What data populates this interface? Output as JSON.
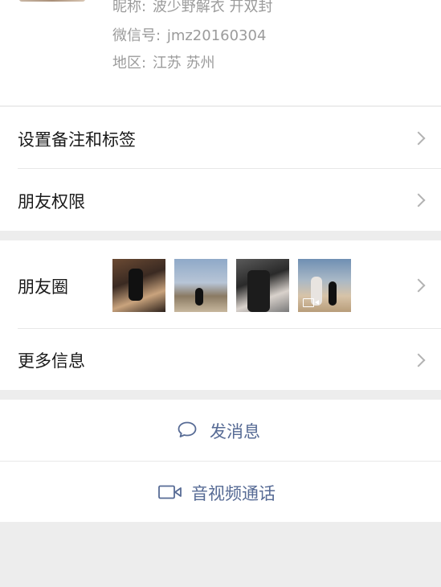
{
  "profile": {
    "nickname_label": "昵称:",
    "nickname_value": "波少野解衣 开双封",
    "wechat_id_label": "微信号:",
    "wechat_id_value": "jmz20160304",
    "region_label": "地区:",
    "region_value": "江苏 苏州"
  },
  "menu": {
    "remark_tags": "设置备注和标签",
    "friend_permissions": "朋友权限",
    "moments": "朋友圈",
    "more_info": "更多信息"
  },
  "moments_thumbnails": [
    {
      "kind": "photo"
    },
    {
      "kind": "photo"
    },
    {
      "kind": "photo"
    },
    {
      "kind": "video"
    }
  ],
  "actions": {
    "send_message": "发消息",
    "av_call": "音视频通话"
  },
  "colors": {
    "link": "#576b95",
    "background": "#ededed",
    "card": "#ffffff"
  },
  "icons": {
    "chevron": "chevron-right-icon",
    "message": "chat-bubble-icon",
    "video": "video-camera-icon"
  }
}
